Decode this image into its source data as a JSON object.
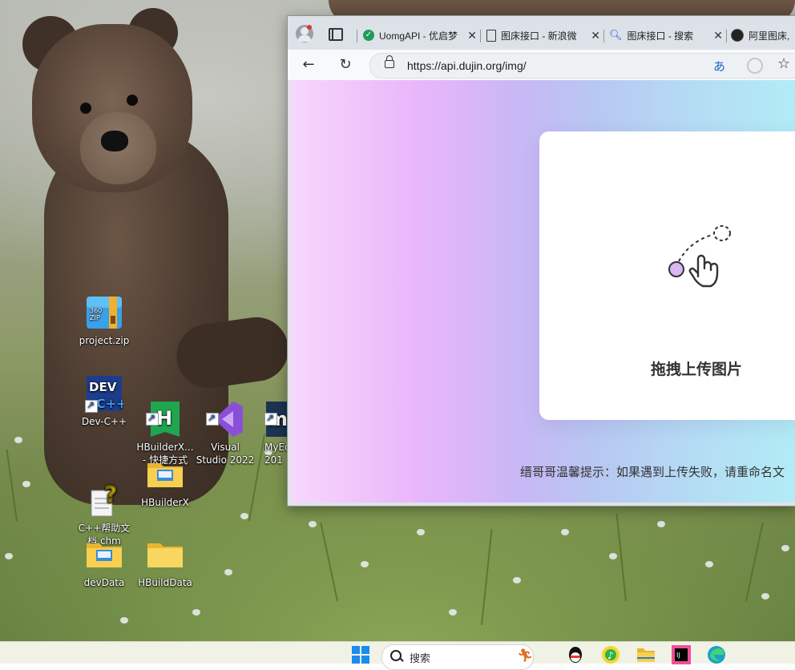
{
  "desktop": {
    "icons": [
      {
        "label": "project.zip",
        "icon": "archive-icon"
      },
      {
        "label": "Dev-C++",
        "icon": "devcpp-icon"
      },
      {
        "label": "HBuilderX...\n- 快捷方式",
        "icon": "hbuilderx-icon"
      },
      {
        "label": "Visual\nStudio 2022",
        "icon": "visual-studio-icon"
      },
      {
        "label": "MyEc\n201",
        "icon": "myeclipse-icon"
      },
      {
        "label": "C++帮助文\n档.chm",
        "icon": "chm-help-icon"
      },
      {
        "label": "HBuilderX",
        "icon": "folder-icon"
      },
      {
        "label": "devData",
        "icon": "folder-icon"
      },
      {
        "label": "HBuildData",
        "icon": "folder-icon"
      }
    ]
  },
  "browser": {
    "tabs": [
      {
        "title": "UomgAPI - 优启梦",
        "icon": "check-circle-icon"
      },
      {
        "title": "图床接口 - 新浪微",
        "icon": "page-icon"
      },
      {
        "title": "图床接口 - 搜索",
        "icon": "search-icon"
      },
      {
        "title": "阿里图床,",
        "icon": "site-logo-icon"
      }
    ],
    "url": "https://api.dujin.org/img/",
    "page": {
      "upload_label": "拖拽上传图片",
      "tip": "缙哥哥温馨提示：如果遇到上传失败，请重命名文"
    }
  },
  "taskbar": {
    "search_label": "搜索",
    "icons": [
      "windows-start-icon",
      "search-icon",
      "widget-icon",
      "qq-icon",
      "music-icon",
      "file-explorer-icon",
      "jetbrains-icon",
      "edge-icon"
    ]
  },
  "colors": {
    "page_gradient_start": "#f8d7fb",
    "page_gradient_end": "#b2ecf5",
    "tab_bar": "#dde2e8"
  }
}
